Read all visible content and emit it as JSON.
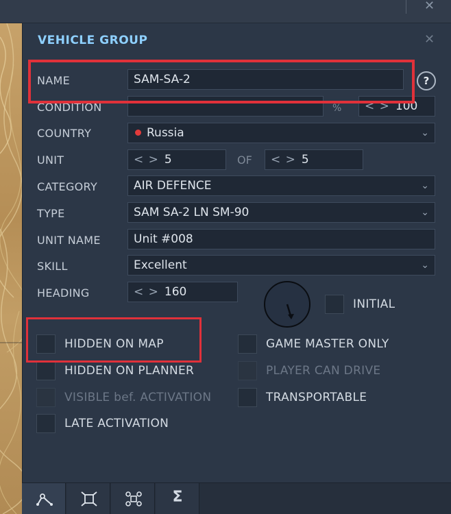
{
  "window": {
    "close_glyph": "✕"
  },
  "panel": {
    "title": "VEHICLE GROUP",
    "close_glyph": "✕",
    "help_glyph": "?"
  },
  "fields": {
    "name": {
      "label": "NAME",
      "value": "SAM-SA-2"
    },
    "condition": {
      "label": "CONDITION",
      "value": "",
      "percent_symbol": "%",
      "percent_value": "100"
    },
    "country": {
      "label": "COUNTRY",
      "value": "Russia",
      "flag_color": "#e23b3b"
    },
    "unit": {
      "label": "UNIT",
      "value": "5",
      "of_label": "OF",
      "of_value": "5"
    },
    "category": {
      "label": "CATEGORY",
      "value": "AIR DEFENCE"
    },
    "type": {
      "label": "TYPE",
      "value": "SAM SA-2 LN SM-90"
    },
    "unit_name": {
      "label": "UNIT NAME",
      "value": "Unit #008"
    },
    "skill": {
      "label": "SKILL",
      "value": "Excellent"
    },
    "heading": {
      "label": "HEADING",
      "value": "160"
    }
  },
  "stepper_glyph": "< >",
  "dropdown_glyph": "⌄",
  "checkboxes": {
    "initial": {
      "label": "INITIAL",
      "checked": false
    },
    "hidden_on_map": {
      "label": "HIDDEN ON MAP",
      "checked": false
    },
    "game_master_only": {
      "label": "GAME MASTER ONLY",
      "checked": false
    },
    "hidden_on_planner": {
      "label": "HIDDEN ON PLANNER",
      "checked": false
    },
    "player_can_drive": {
      "label": "PLAYER CAN DRIVE",
      "checked": false,
      "enabled": false
    },
    "visible_before_activation": {
      "label": "VISIBLE bef. ACTIVATION",
      "checked": false,
      "enabled": false
    },
    "transportable": {
      "label": "TRANSPORTABLE",
      "checked": false
    },
    "late_activation": {
      "label": "LATE ACTIVATION",
      "checked": false
    }
  },
  "toolbar": {
    "buttons": [
      "route-icon",
      "target-icon",
      "group-icon",
      "sigma-icon"
    ],
    "sigma_glyph": "Σ"
  },
  "colors": {
    "title": "#8ed0ff",
    "highlight": "#e0313a",
    "panel_bg": "#2c3747"
  }
}
